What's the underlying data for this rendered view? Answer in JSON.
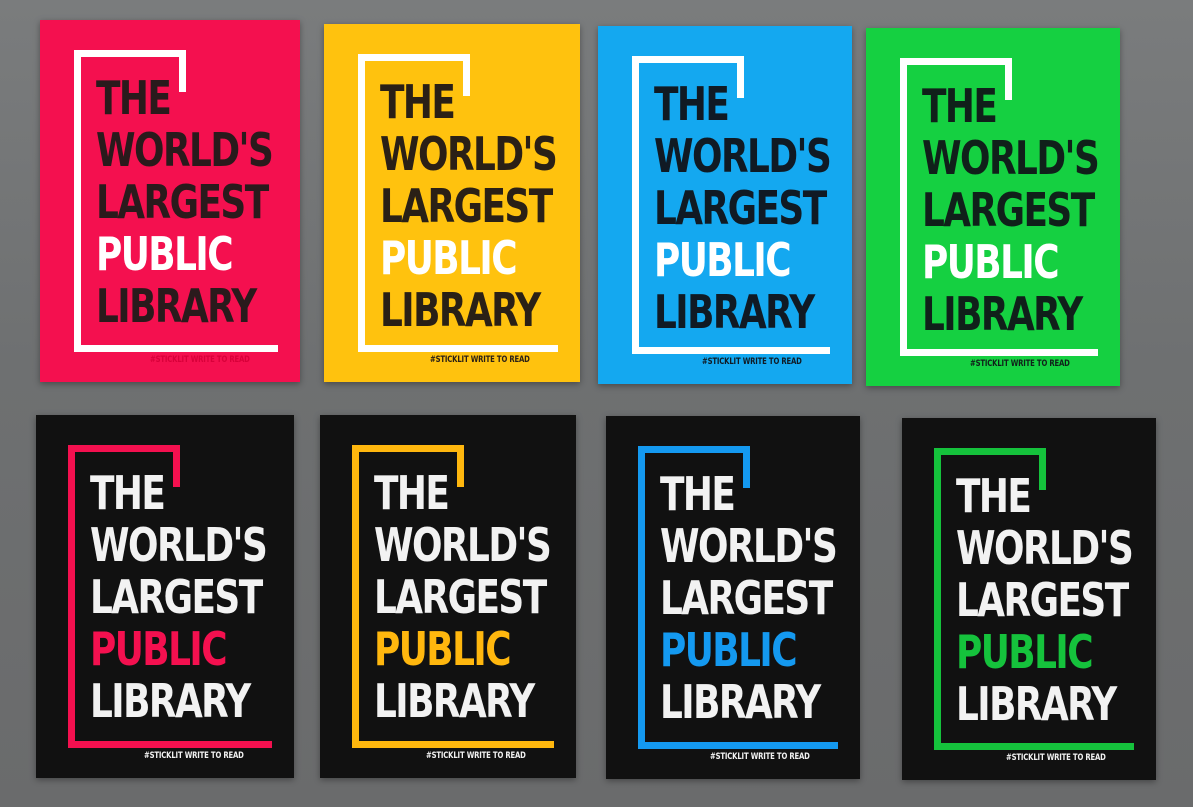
{
  "posters": [
    {
      "title_lines": [
        "THE",
        "WORLD'S",
        "LARGEST",
        "PUBLIC",
        "LIBRARY"
      ],
      "tag": "#STICKLIT WRITE TO READ",
      "bg": "#f4104f",
      "frame": "#ffffff",
      "ink": "#2a1a1c",
      "accent": "#ffffff",
      "tag_color": "#d9003a"
    },
    {
      "title_lines": [
        "THE",
        "WORLD'S",
        "LARGEST",
        "PUBLIC",
        "LIBRARY"
      ],
      "tag": "#STICKLIT WRITE TO READ",
      "bg": "#ffc20e",
      "frame": "#ffffff",
      "ink": "#2a2016",
      "accent": "#ffffff",
      "tag_color": "#2a2016"
    },
    {
      "title_lines": [
        "THE",
        "WORLD'S",
        "LARGEST",
        "PUBLIC",
        "LIBRARY"
      ],
      "tag": "#STICKLIT WRITE TO READ",
      "bg": "#14a8f0",
      "frame": "#ffffff",
      "ink": "#101a24",
      "accent": "#ffffff",
      "tag_color": "#101a24"
    },
    {
      "title_lines": [
        "THE",
        "WORLD'S",
        "LARGEST",
        "PUBLIC",
        "LIBRARY"
      ],
      "tag": "#STICKLIT WRITE TO READ",
      "bg": "#15d041",
      "frame": "#ffffff",
      "ink": "#10201a",
      "accent": "#ffffff",
      "tag_color": "#10201a"
    },
    {
      "title_lines": [
        "THE",
        "WORLD'S",
        "LARGEST",
        "PUBLIC",
        "LIBRARY"
      ],
      "tag": "#STICKLIT WRITE TO READ",
      "bg": "#111111",
      "frame": "#f4104f",
      "ink": "#f2f2f2",
      "accent": "#f4104f",
      "tag_color": "#f2f2f2"
    },
    {
      "title_lines": [
        "THE",
        "WORLD'S",
        "LARGEST",
        "PUBLIC",
        "LIBRARY"
      ],
      "tag": "#STICKLIT WRITE TO READ",
      "bg": "#111111",
      "frame": "#ffb70e",
      "ink": "#f2f2f2",
      "accent": "#ffb70e",
      "tag_color": "#f2f2f2"
    },
    {
      "title_lines": [
        "THE",
        "WORLD'S",
        "LARGEST",
        "PUBLIC",
        "LIBRARY"
      ],
      "tag": "#STICKLIT WRITE TO READ",
      "bg": "#111111",
      "frame": "#1499f0",
      "ink": "#f2f2f2",
      "accent": "#1499f0",
      "tag_color": "#f2f2f2"
    },
    {
      "title_lines": [
        "THE",
        "WORLD'S",
        "LARGEST",
        "PUBLIC",
        "LIBRARY"
      ],
      "tag": "#STICKLIT WRITE TO READ",
      "bg": "#111111",
      "frame": "#15c23c",
      "ink": "#f2f2f2",
      "accent": "#15c23c",
      "tag_color": "#f2f2f2"
    }
  ]
}
